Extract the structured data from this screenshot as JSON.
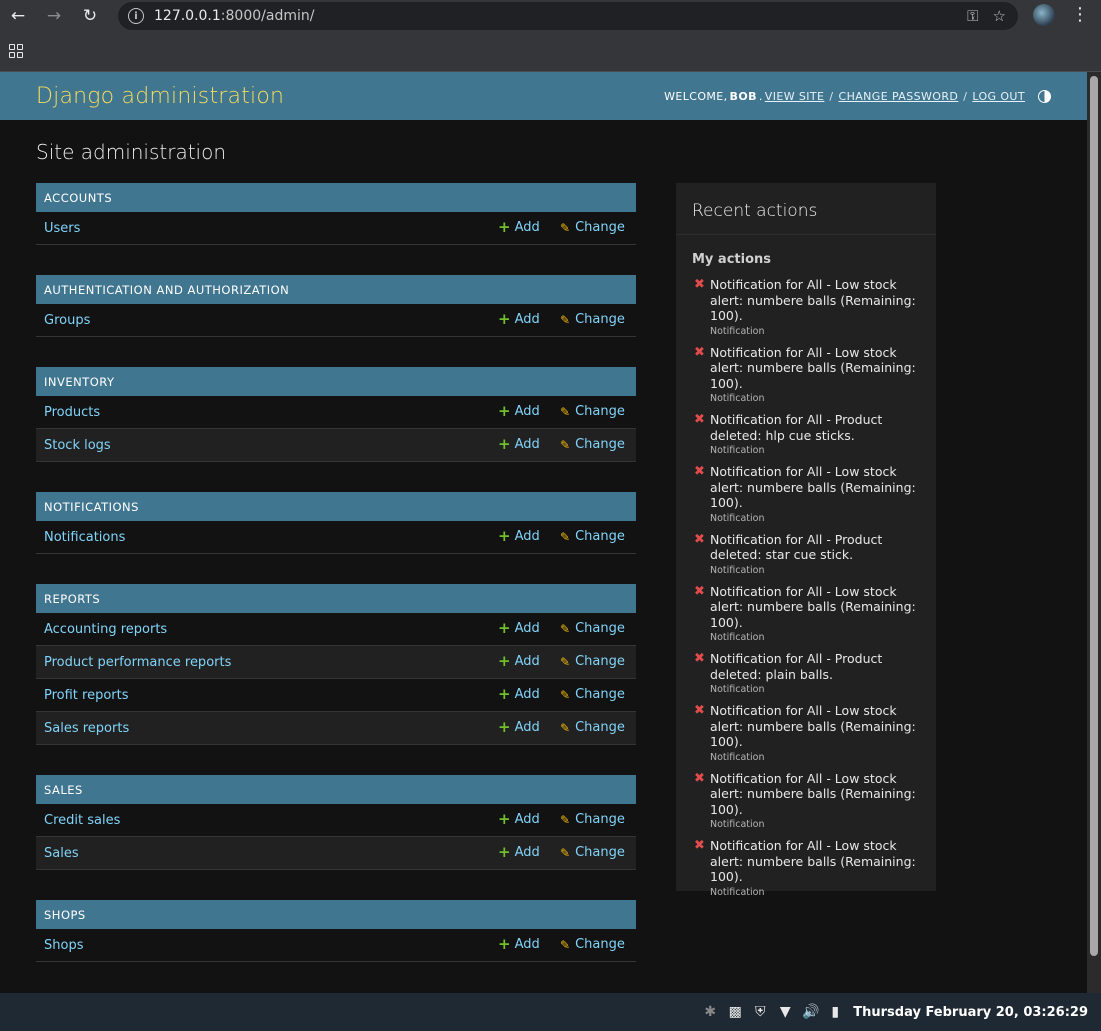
{
  "browser": {
    "url_host": "127.0.0.1",
    "url_rest": ":8000/admin/"
  },
  "header": {
    "branding": "Django administration",
    "welcome_label": "WELCOME,",
    "username": "BOB",
    "view_site": "VIEW SITE",
    "change_password": "CHANGE PASSWORD",
    "log_out": "LOG OUT"
  },
  "content": {
    "title": "Site administration",
    "add_label": "Add",
    "change_label": "Change"
  },
  "modules": [
    {
      "caption": "Accounts",
      "models": [
        "Users"
      ]
    },
    {
      "caption": "Authentication and Authorization",
      "models": [
        "Groups"
      ]
    },
    {
      "caption": "Inventory",
      "models": [
        "Products",
        "Stock logs"
      ]
    },
    {
      "caption": "Notifications",
      "models": [
        "Notifications"
      ]
    },
    {
      "caption": "Reports",
      "models": [
        "Accounting reports",
        "Product performance reports",
        "Profit reports",
        "Sales reports"
      ]
    },
    {
      "caption": "Sales",
      "models": [
        "Credit sales",
        "Sales"
      ]
    },
    {
      "caption": "Shops",
      "models": [
        "Shops"
      ]
    }
  ],
  "recent_actions": {
    "title": "Recent actions",
    "subtitle": "My actions",
    "items": [
      {
        "text": "Notification for All - Low stock alert: numbere balls (Remaining: 100).",
        "type": "Notification"
      },
      {
        "text": "Notification for All - Low stock alert: numbere balls (Remaining: 100).",
        "type": "Notification"
      },
      {
        "text": "Notification for All - Product deleted: hlp cue sticks.",
        "type": "Notification"
      },
      {
        "text": "Notification for All - Low stock alert: numbere balls (Remaining: 100).",
        "type": "Notification"
      },
      {
        "text": "Notification for All - Product deleted: star cue stick.",
        "type": "Notification"
      },
      {
        "text": "Notification for All - Low stock alert: numbere balls (Remaining: 100).",
        "type": "Notification"
      },
      {
        "text": "Notification for All - Product deleted: plain balls.",
        "type": "Notification"
      },
      {
        "text": "Notification for All - Low stock alert: numbere balls (Remaining: 100).",
        "type": "Notification"
      },
      {
        "text": "Notification for All - Low stock alert: numbere balls (Remaining: 100).",
        "type": "Notification"
      },
      {
        "text": "Notification for All - Low stock alert: numbere balls (Remaining: 100).",
        "type": "Notification"
      }
    ]
  },
  "taskbar": {
    "clock": "Thursday February 20, 03:26:29"
  },
  "colors": {
    "header_bg": "#417690",
    "branding": "#f5dd5d",
    "link": "#81d4fa",
    "add_icon": "#70bf2b",
    "change_icon": "#efb80b",
    "delete_icon": "#e34c4c"
  },
  "icons": [
    "back-arrow-icon",
    "forward-arrow-icon",
    "reload-icon",
    "site-info-icon",
    "password-key-icon",
    "bookmark-star-icon",
    "profile-avatar-icon",
    "menu-dots-icon",
    "apps-grid-icon",
    "theme-toggle-icon",
    "add-plus-icon",
    "change-pencil-icon",
    "delete-x-icon",
    "bluetooth-icon",
    "clipboard-icon",
    "shield-icon",
    "wifi-icon",
    "volume-icon",
    "battery-icon"
  ]
}
